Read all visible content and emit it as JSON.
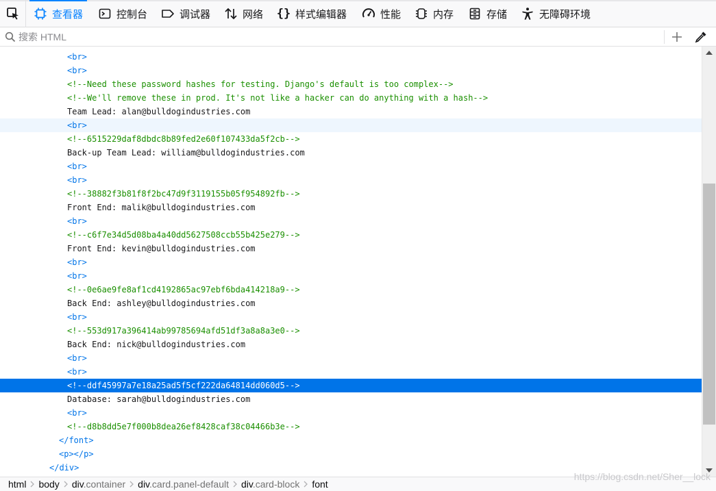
{
  "toolbar": {
    "tabs": [
      {
        "label": "查看器",
        "icon": "inspector-icon",
        "active": true
      },
      {
        "label": "控制台",
        "icon": "console-icon",
        "active": false
      },
      {
        "label": "调试器",
        "icon": "debugger-icon",
        "active": false
      },
      {
        "label": "网络",
        "icon": "network-icon",
        "active": false
      },
      {
        "label": "样式编辑器",
        "icon": "style-editor-icon",
        "active": false
      },
      {
        "label": "性能",
        "icon": "performance-icon",
        "active": false
      },
      {
        "label": "内存",
        "icon": "memory-icon",
        "active": false
      },
      {
        "label": "存储",
        "icon": "storage-icon",
        "active": false
      },
      {
        "label": "无障碍环境",
        "icon": "accessibility-icon",
        "active": false
      }
    ]
  },
  "search": {
    "placeholder": "搜索 HTML"
  },
  "markup": {
    "lines": [
      {
        "indent": 98,
        "parts": [
          {
            "k": "tag",
            "t": "<br>"
          }
        ]
      },
      {
        "indent": 98,
        "parts": [
          {
            "k": "tag",
            "t": "<br>"
          }
        ]
      },
      {
        "indent": 98,
        "parts": [
          {
            "k": "cmt",
            "t": "<!--Need these password hashes for testing. Django's default is too complex-->"
          }
        ]
      },
      {
        "indent": 98,
        "parts": [
          {
            "k": "cmt",
            "t": "<!--We'll remove these in prod. It's not like a hacker can do anything with a hash-->"
          }
        ]
      },
      {
        "indent": 98,
        "parts": [
          {
            "k": "txt",
            "t": "Team Lead: alan@bulldogindustries.com"
          }
        ]
      },
      {
        "indent": 98,
        "parts": [
          {
            "k": "tag",
            "t": "<br>"
          }
        ],
        "state": "hover"
      },
      {
        "indent": 98,
        "parts": [
          {
            "k": "cmt",
            "t": "<!--6515229daf8dbdc8b89fed2e60f107433da5f2cb-->"
          }
        ]
      },
      {
        "indent": 98,
        "parts": [
          {
            "k": "txt",
            "t": "Back-up Team Lead: william@bulldogindustries.com"
          }
        ]
      },
      {
        "indent": 98,
        "parts": [
          {
            "k": "tag",
            "t": "<br>"
          }
        ]
      },
      {
        "indent": 98,
        "parts": [
          {
            "k": "tag",
            "t": "<br>"
          }
        ]
      },
      {
        "indent": 98,
        "parts": [
          {
            "k": "cmt",
            "t": "<!--38882f3b81f8f2bc47d9f3119155b05f954892fb-->"
          }
        ]
      },
      {
        "indent": 98,
        "parts": [
          {
            "k": "txt",
            "t": "Front End: malik@bulldogindustries.com"
          }
        ]
      },
      {
        "indent": 98,
        "parts": [
          {
            "k": "tag",
            "t": "<br>"
          }
        ]
      },
      {
        "indent": 98,
        "parts": [
          {
            "k": "cmt",
            "t": "<!--c6f7e34d5d08ba4a40dd5627508ccb55b425e279-->"
          }
        ]
      },
      {
        "indent": 98,
        "parts": [
          {
            "k": "txt",
            "t": "Front End: kevin@bulldogindustries.com"
          }
        ]
      },
      {
        "indent": 98,
        "parts": [
          {
            "k": "tag",
            "t": "<br>"
          }
        ]
      },
      {
        "indent": 98,
        "parts": [
          {
            "k": "tag",
            "t": "<br>"
          }
        ]
      },
      {
        "indent": 98,
        "parts": [
          {
            "k": "cmt",
            "t": "<!--0e6ae9fe8af1cd4192865ac97ebf6bda414218a9-->"
          }
        ]
      },
      {
        "indent": 98,
        "parts": [
          {
            "k": "txt",
            "t": "Back End: ashley@bulldogindustries.com"
          }
        ]
      },
      {
        "indent": 98,
        "parts": [
          {
            "k": "tag",
            "t": "<br>"
          }
        ]
      },
      {
        "indent": 98,
        "parts": [
          {
            "k": "cmt",
            "t": "<!--553d917a396414ab99785694afd51df3a8a8a3e0-->"
          }
        ]
      },
      {
        "indent": 98,
        "parts": [
          {
            "k": "txt",
            "t": "Back End: nick@bulldogindustries.com"
          }
        ]
      },
      {
        "indent": 98,
        "parts": [
          {
            "k": "tag",
            "t": "<br>"
          }
        ]
      },
      {
        "indent": 98,
        "parts": [
          {
            "k": "tag",
            "t": "<br>"
          }
        ]
      },
      {
        "indent": 98,
        "parts": [
          {
            "k": "cmt",
            "t": "<!--ddf45997a7e18a25ad5f5cf222da64814dd060d5-->"
          }
        ],
        "state": "selected"
      },
      {
        "indent": 98,
        "parts": [
          {
            "k": "txt",
            "t": "Database: sarah@bulldogindustries.com"
          }
        ]
      },
      {
        "indent": 98,
        "parts": [
          {
            "k": "tag",
            "t": "<br>"
          }
        ]
      },
      {
        "indent": 98,
        "parts": [
          {
            "k": "cmt",
            "t": "<!--d8b8dd5e7f000b8dea26ef8428caf38c04466b3e-->"
          }
        ]
      },
      {
        "indent": 86,
        "parts": [
          {
            "k": "tag",
            "t": "</font>"
          }
        ]
      },
      {
        "indent": 86,
        "parts": [
          {
            "k": "tag",
            "t": "<p></p>"
          }
        ]
      },
      {
        "indent": 72,
        "parts": [
          {
            "k": "tag",
            "t": "</div>"
          }
        ]
      }
    ]
  },
  "breadcrumbs": [
    {
      "tag": "html",
      "cls": ""
    },
    {
      "tag": "body",
      "cls": ""
    },
    {
      "tag": "div",
      "cls": ".container"
    },
    {
      "tag": "div",
      "cls": ".card.panel-default"
    },
    {
      "tag": "div",
      "cls": ".card-block"
    },
    {
      "tag": "font",
      "cls": ""
    }
  ],
  "watermark": "https://blog.csdn.net/Sher__lock",
  "colors": {
    "accent": "#0a84ff",
    "selection": "#0074e8",
    "comment": "#1a8f00",
    "tag": "#0074e8"
  }
}
